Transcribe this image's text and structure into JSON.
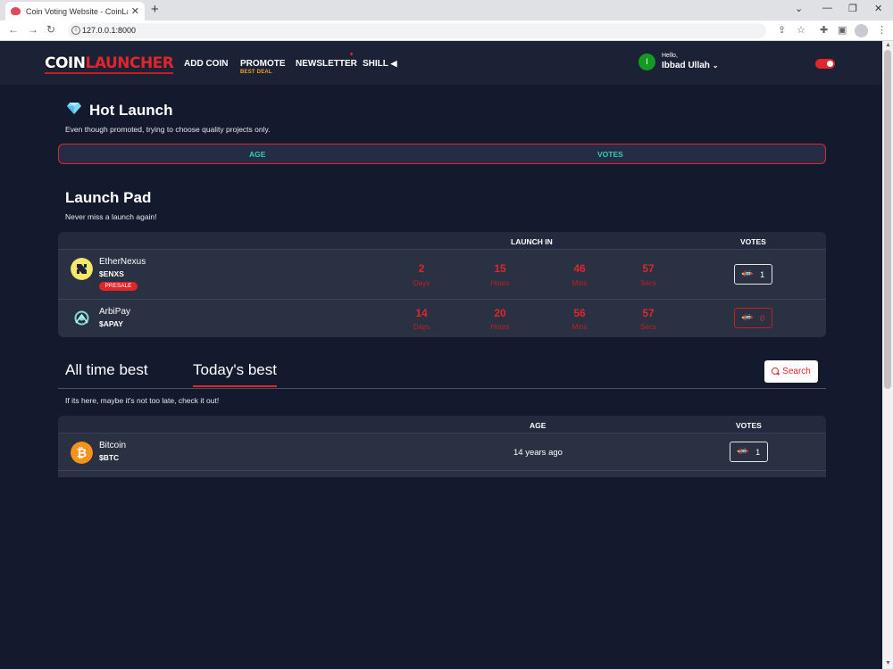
{
  "browser": {
    "tab_title": "Coin Voting Website - CoinLaunch",
    "tab_close": "✕",
    "new_tab": "+",
    "url": "127.0.0.1:8000",
    "controls": [
      "⌄",
      "—",
      "❐",
      "✕"
    ],
    "nav": [
      "←",
      "→",
      "↻"
    ],
    "extensions": [
      "⇪",
      "☆",
      "✚",
      "▣"
    ],
    "info": "i"
  },
  "header": {
    "logo_part1": "COIN",
    "logo_part2": "LAUNCHER",
    "menu": {
      "add_coin": "ADD COIN",
      "promote": "PROMOTE",
      "promote_sub": "BEST DEAL",
      "newsletter": "NEWSLETTER",
      "shill": "SHILL"
    },
    "user_initial": "I",
    "hello": "Hello,",
    "user_name": "Ibbad Ullah"
  },
  "hot_launch": {
    "title": "Hot Launch",
    "subtitle": "Even though promoted, trying to choose quality projects only.",
    "col_age": "AGE",
    "col_votes": "VOTES"
  },
  "launch_pad": {
    "title": "Launch Pad",
    "subtitle": "Never miss a launch again!",
    "col_launch_in": "LAUNCH IN",
    "col_votes": "VOTES",
    "rows": [
      {
        "name": "EtherNexus",
        "symbol": "$ENXS",
        "badge": "PRESALE",
        "days": "2",
        "hours": "15",
        "mins": "46",
        "secs": "57",
        "votes": "1"
      },
      {
        "name": "ArbiPay",
        "symbol": "$APAY",
        "days": "14",
        "hours": "20",
        "mins": "56",
        "secs": "57",
        "votes": "0"
      }
    ],
    "labels": {
      "days": "Days",
      "hours": "Hours",
      "mins": "Mins",
      "secs": "Secs"
    }
  },
  "best": {
    "tab_all_time": "All time best",
    "tab_today": "Today's best",
    "search": "Search",
    "subtitle": "If its here, maybe it's not too late, check it out!",
    "col_age": "AGE",
    "col_votes": "VOTES",
    "rows": [
      {
        "name": "Bitcoin",
        "symbol": "$BTC",
        "age": "14 years ago",
        "votes": "1"
      }
    ]
  },
  "colors": {
    "background": "#141a2d",
    "accent_red": "#e0262b",
    "teal": "#2fd0b5",
    "bitcoin_orange": "#f7931a"
  }
}
